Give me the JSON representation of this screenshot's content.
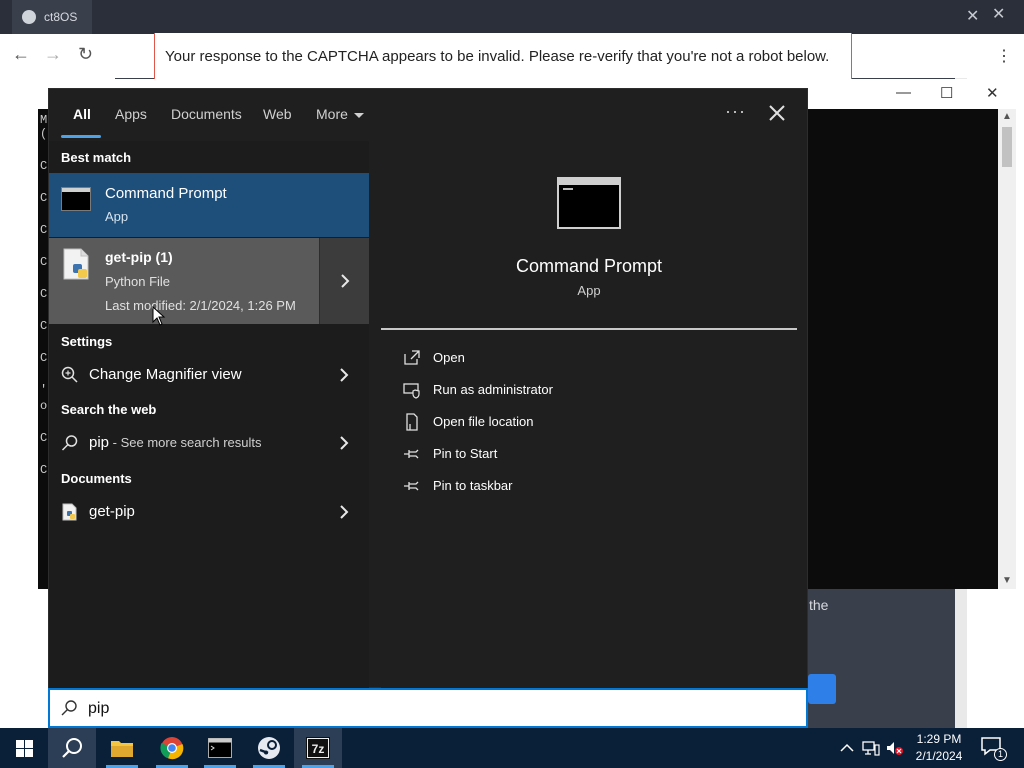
{
  "browser": {
    "tab_title": "ct8OS",
    "captcha_message": "Your response to the CAPTCHA appears to be invalid. Please re-verify that you're not a robot below.",
    "page_fragment": "the"
  },
  "console": {
    "line_glyphs": [
      "M",
      "(",
      "C",
      "C",
      "C",
      "C",
      "C",
      "C",
      "C",
      "'",
      "o",
      "C",
      "C"
    ]
  },
  "search": {
    "tabs": [
      {
        "label": "All",
        "active": true
      },
      {
        "label": "Apps"
      },
      {
        "label": "Documents"
      },
      {
        "label": "Web"
      },
      {
        "label": "More"
      }
    ],
    "options_label": "···",
    "query": "pip",
    "sections": {
      "best_match": "Best match",
      "settings": "Settings",
      "search_web": "Search the web",
      "documents": "Documents"
    },
    "best_match": {
      "name": "Command Prompt",
      "type": "App"
    },
    "file_result": {
      "name": "get-pip (1)",
      "type": "Python File",
      "modified": "Last modified: 2/1/2024, 1:26 PM"
    },
    "settings_item": "Change Magnifier view",
    "web_item": {
      "query": "pip",
      "suffix": " - See more search results"
    },
    "document_item": "get-pip",
    "details": {
      "name": "Command Prompt",
      "type": "App",
      "actions": [
        "Open",
        "Run as administrator",
        "Open file location",
        "Pin to Start",
        "Pin to taskbar"
      ]
    }
  },
  "taskbar": {
    "time": "1:29 PM",
    "date": "2/1/2024",
    "notification_count": "1"
  },
  "colors": {
    "accent": "#0078d4",
    "selected": "#1e4e7a",
    "taskbar": "#0a1f38"
  }
}
